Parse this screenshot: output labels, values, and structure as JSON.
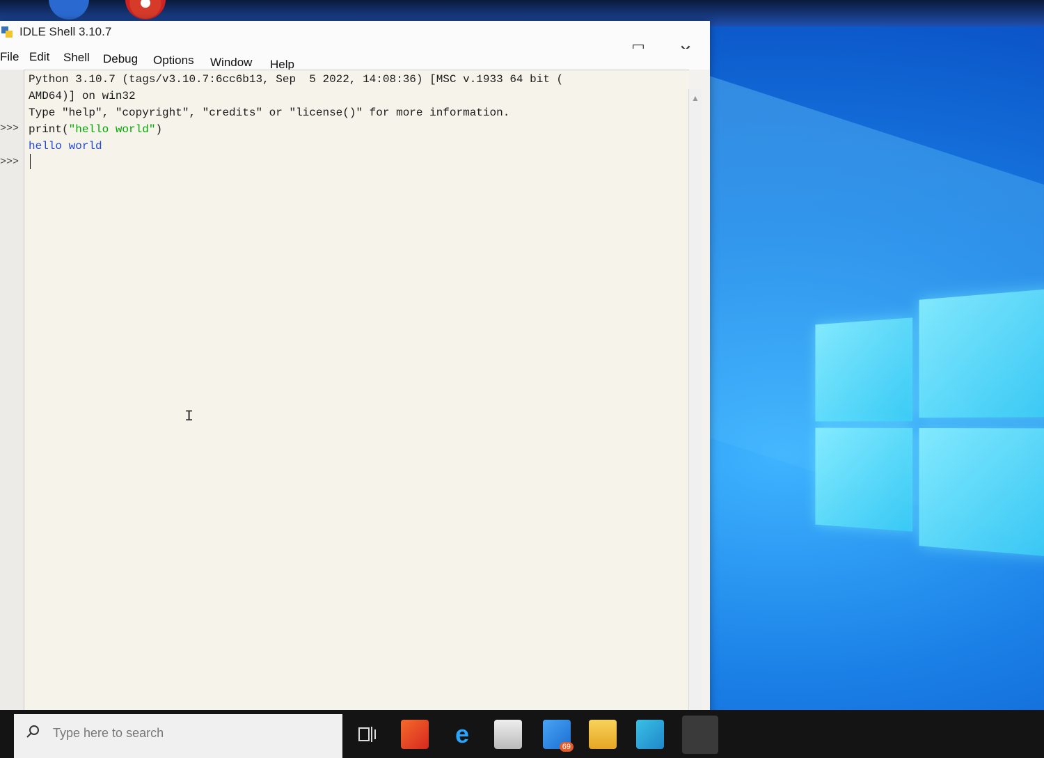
{
  "window": {
    "title": "IDLE Shell 3.10.7",
    "controls": {
      "minimize": "—",
      "maximize": "☐",
      "close": "✕"
    }
  },
  "menu": [
    "File",
    "Edit",
    "Shell",
    "Debug",
    "Options",
    "Window",
    "Help"
  ],
  "shell": {
    "banner_line1": "Python 3.10.7 (tags/v3.10.7:6cc6b13, Sep  5 2022, 14:08:36) [MSC v.1933 64 bit (",
    "banner_line2": "AMD64)] on win32",
    "banner_line3": "Type \"help\", \"copyright\", \"credits\" or \"license()\" for more information.",
    "prompt": ">>>",
    "command_prefix": "print(",
    "command_string": "\"hello world\"",
    "command_suffix": ")",
    "output": "hello world"
  },
  "taskbar": {
    "search_placeholder": "Type here to search",
    "mail_badge": "69"
  },
  "colors": {
    "accent": "#0b55c8",
    "string_green": "#00aa00",
    "output_blue": "#2148d8"
  }
}
